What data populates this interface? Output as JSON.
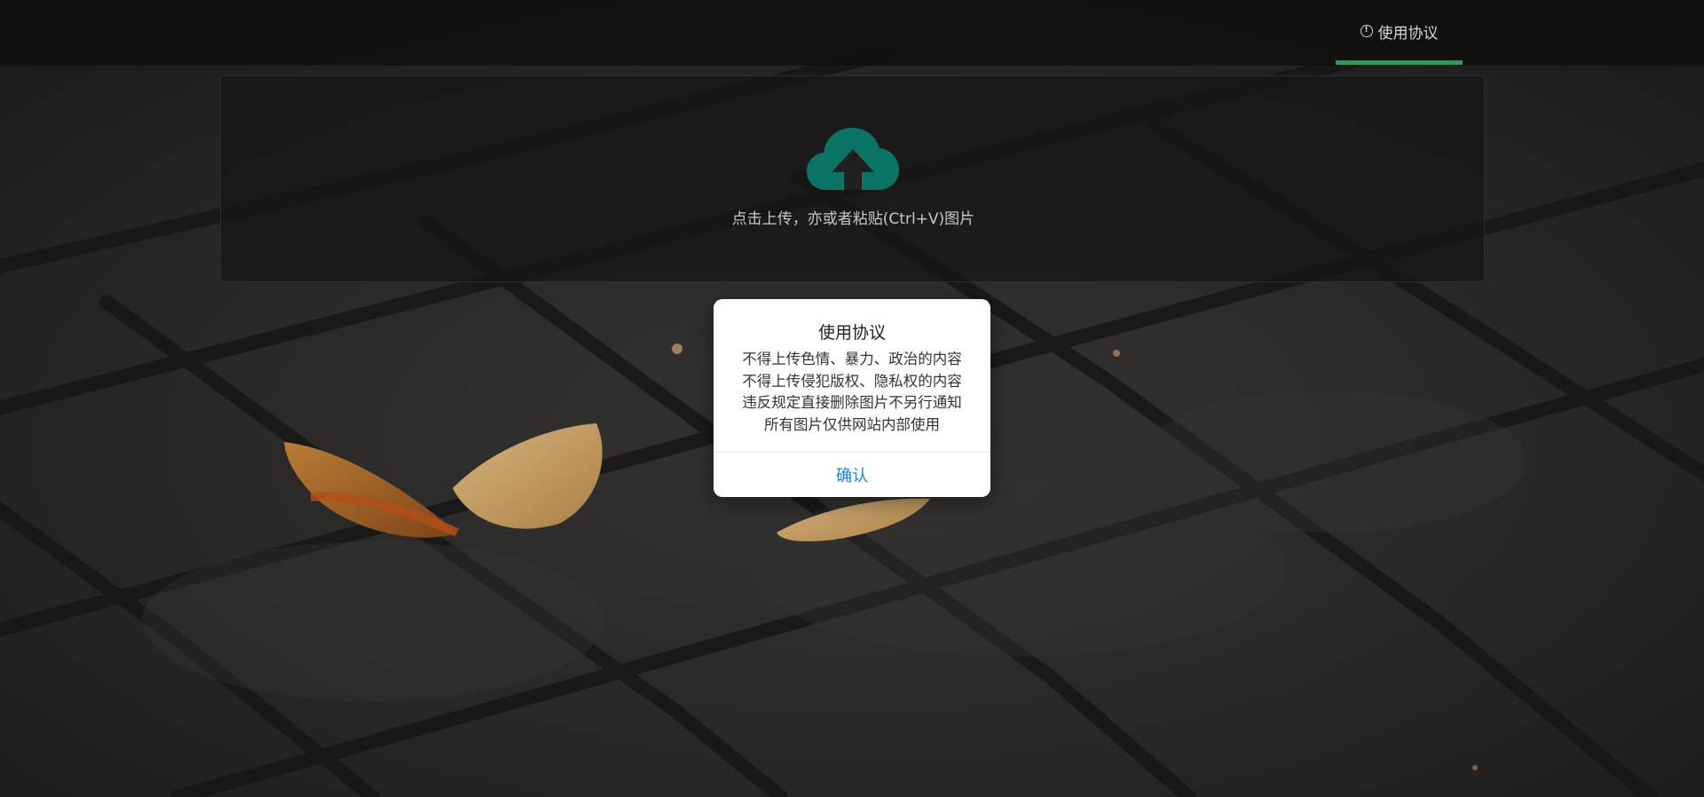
{
  "nav": {
    "agreement_label": "使用协议",
    "active_underline_color": "#3aa06a"
  },
  "upload": {
    "hint": "点击上传，亦或者粘贴(Ctrl+V)图片",
    "icon": "cloud-upload-icon",
    "icon_color": "#0e7e6f"
  },
  "modal": {
    "title": "使用协议",
    "lines": [
      "不得上传色情、暴力、政治的内容",
      "不得上传侵犯版权、隐私权的内容",
      "违反规定直接删除图片不另行通知",
      "所有图片仅供网站内部使用"
    ],
    "confirm_label": "确认",
    "confirm_color": "#1e7fd9"
  }
}
